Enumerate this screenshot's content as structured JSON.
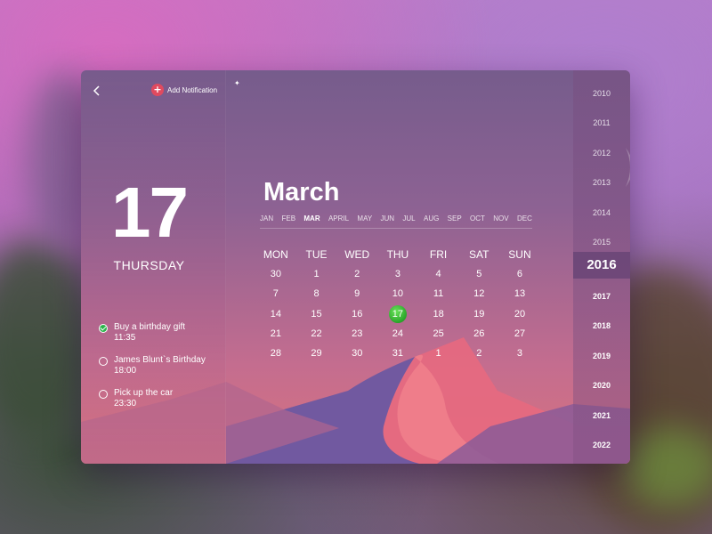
{
  "header": {
    "add_notification_label": "Add Notification"
  },
  "selected_day": {
    "number": "17",
    "weekday": "THURSDAY"
  },
  "todos": [
    {
      "title": "Buy a birthday gift",
      "time": "11:35",
      "done": true
    },
    {
      "title": "James Blunt`s Birthday",
      "time": "18:00",
      "done": false
    },
    {
      "title": "Pick up the car",
      "time": "23:30",
      "done": false
    }
  ],
  "calendar": {
    "month_title": "March",
    "months": [
      "JAN",
      "FEB",
      "MAR",
      "APRIL",
      "MAY",
      "JUN",
      "JUL",
      "AUG",
      "SEP",
      "OCT",
      "NOV",
      "DEC"
    ],
    "active_month": "MAR",
    "weekdays": [
      "MON",
      "TUE",
      "WED",
      "THU",
      "FRI",
      "SAT",
      "SUN"
    ],
    "weeks": [
      [
        "30",
        "1",
        "2",
        "3",
        "4",
        "5",
        "6"
      ],
      [
        "7",
        "8",
        "9",
        "10",
        "11",
        "12",
        "13"
      ],
      [
        "14",
        "15",
        "16",
        "17",
        "18",
        "19",
        "20"
      ],
      [
        "21",
        "22",
        "23",
        "24",
        "25",
        "26",
        "27"
      ],
      [
        "28",
        "29",
        "30",
        "31",
        "1",
        "2",
        "3"
      ]
    ],
    "selected_date": "17"
  },
  "years": {
    "list": [
      "2010",
      "2011",
      "2012",
      "2013",
      "2014",
      "2015",
      "2016",
      "2017",
      "2018",
      "2019",
      "2020",
      "2021",
      "2022"
    ],
    "active": "2016"
  },
  "colors": {
    "accent_red": "#e04a5f",
    "selected_green": "#2aa52a"
  }
}
